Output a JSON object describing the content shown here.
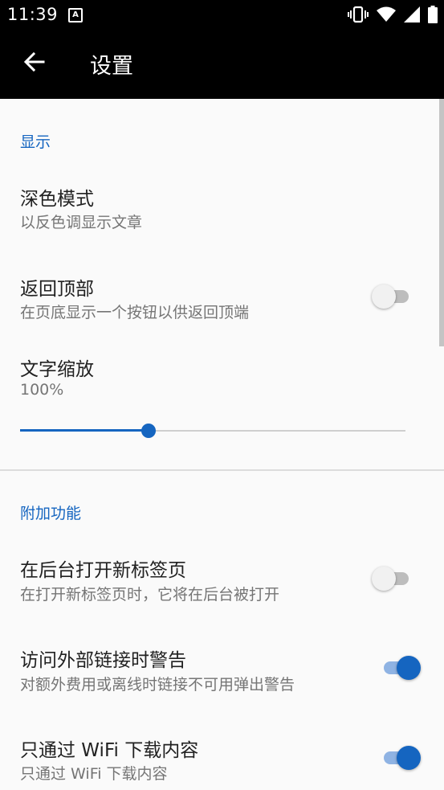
{
  "status_bar": {
    "time": "11:39",
    "icons": [
      "a-badge-icon",
      "vibrate-icon",
      "wifi-icon",
      "signal-icon",
      "battery-icon"
    ]
  },
  "toolbar": {
    "title": "设置"
  },
  "sections": {
    "display": {
      "header": "显示",
      "dark_mode": {
        "title": "深色模式",
        "subtitle": "以反色调显示文章"
      },
      "back_to_top": {
        "title": "返回顶部",
        "subtitle": "在页底显示一个按钮以供返回顶端",
        "enabled": false
      },
      "text_scale": {
        "title": "文字缩放",
        "value_label": "100%",
        "slider_fraction": 0.334
      }
    },
    "extras": {
      "header": "附加功能",
      "open_in_background": {
        "title": "在后台打开新标签页",
        "subtitle": "在打开新标签页时，它将在后台被打开",
        "enabled": false
      },
      "external_link_warning": {
        "title": "访问外部链接时警告",
        "subtitle": "对额外费用或离线时链接不可用弹出警告",
        "enabled": true
      },
      "wifi_only_download": {
        "title": "只通过 WiFi 下载内容",
        "subtitle": "只通过 WiFi 下载内容",
        "enabled": true
      }
    }
  },
  "colors": {
    "accent": "#1565c0",
    "toolbar": "#000000",
    "background": "#fafafa"
  }
}
